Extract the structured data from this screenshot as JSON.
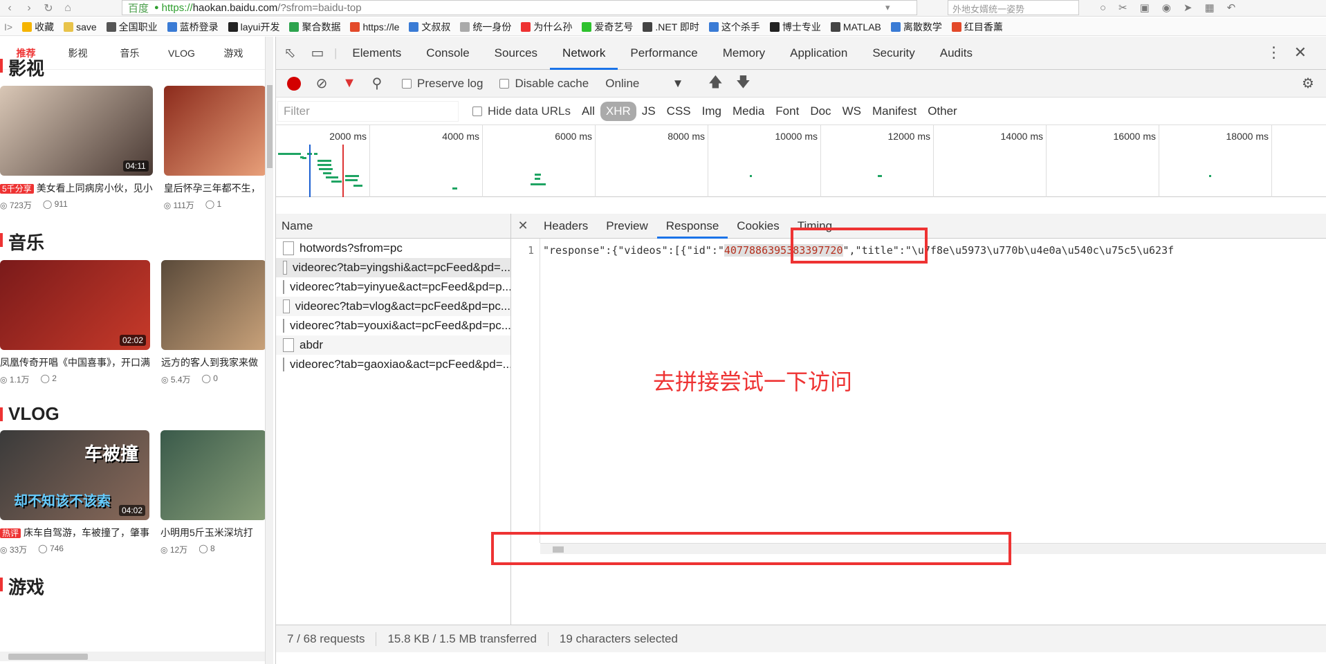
{
  "browser": {
    "site_badge": "百度",
    "url_https": "https://",
    "url_host": "haokan.baidu.com",
    "url_path": "/?sfrom=baidu-top",
    "search_placeholder": "外地女婿统一姿势"
  },
  "bookmarks": [
    {
      "label": "收藏",
      "color": "#f5b400"
    },
    {
      "label": "save",
      "color": "#e8c34a"
    },
    {
      "label": "全国职业",
      "color": "#555"
    },
    {
      "label": "蓝桥登录",
      "color": "#3a7bd5"
    },
    {
      "label": "layui开发",
      "color": "#222"
    },
    {
      "label": "聚合数据",
      "color": "#2ea44f"
    },
    {
      "label": "https://le",
      "color": "#e34a2a"
    },
    {
      "label": "文叔叔",
      "color": "#3a7bd5"
    },
    {
      "label": "统一身份",
      "color": "#aaa"
    },
    {
      "label": "为什么孙",
      "color": "#e33"
    },
    {
      "label": "爱奇艺号",
      "color": "#2ec22e"
    },
    {
      "label": ".NET 即时",
      "color": "#444"
    },
    {
      "label": "这个杀手",
      "color": "#3a7bd5"
    },
    {
      "label": "博士专业",
      "color": "#222"
    },
    {
      "label": "MATLAB",
      "color": "#444"
    },
    {
      "label": "离散数学",
      "color": "#3a7bd5"
    },
    {
      "label": "红目香薰",
      "color": "#e34a2a"
    }
  ],
  "page": {
    "tabs": [
      "推荐",
      "影视",
      "音乐",
      "VLOG",
      "游戏"
    ],
    "sections": [
      {
        "title": "影视",
        "cards": [
          {
            "duration": "04:11",
            "tag": "5千分享",
            "title": "美女看上同病房小伙，见小",
            "views": "723万",
            "comments": "911",
            "bg": "linear-gradient(135deg,#d9c7b6,#4a3a34)"
          },
          {
            "duration": "",
            "tag": "",
            "title": "皇后怀孕三年都不生，",
            "views": "111万",
            "comments": "1",
            "bg": "linear-gradient(135deg,#8c2b1c,#e8a07a)"
          }
        ]
      },
      {
        "title": "音乐",
        "cards": [
          {
            "duration": "02:02",
            "tag": "",
            "title": "凤凰传奇开唱《中国喜事》，开口满",
            "views": "1.1万",
            "comments": "2",
            "bg": "linear-gradient(135deg,#7a1a1a,#c73a2a)"
          },
          {
            "duration": "",
            "tag": "",
            "title": "远方的客人到我家来做",
            "views": "5.4万",
            "comments": "0",
            "bg": "linear-gradient(135deg,#5a4a3a,#c9a27a)"
          }
        ]
      },
      {
        "title": "VLOG",
        "cards": [
          {
            "duration": "04:02",
            "tag": "热评",
            "title": "床车自驾游，车被撞了，肇事",
            "views": "33万",
            "comments": "746",
            "bg": "linear-gradient(135deg,#3a3a3a,#8a6a5a)",
            "overlay1": "车被撞",
            "overlay2": "却不知该不该索"
          },
          {
            "duration": "",
            "tag": "",
            "title": "小明用5斤玉米深坑打",
            "views": "12万",
            "comments": "8",
            "bg": "linear-gradient(135deg,#3a5a4a,#8aa07a)"
          }
        ]
      },
      {
        "title": "游戏",
        "cards": []
      }
    ]
  },
  "devtools": {
    "tabs": [
      "Elements",
      "Console",
      "Sources",
      "Network",
      "Performance",
      "Memory",
      "Application",
      "Security",
      "Audits"
    ],
    "active_tab": "Network",
    "toolbar": {
      "preserve_log": "Preserve log",
      "disable_cache": "Disable cache",
      "throttle": "Online"
    },
    "filter": {
      "placeholder": "Filter",
      "hide_data_urls": "Hide data URLs",
      "types": [
        "All",
        "XHR",
        "JS",
        "CSS",
        "Img",
        "Media",
        "Font",
        "Doc",
        "WS",
        "Manifest",
        "Other"
      ],
      "active_type": "XHR"
    },
    "timeline_ticks": [
      "2000 ms",
      "4000 ms",
      "6000 ms",
      "8000 ms",
      "10000 ms",
      "12000 ms",
      "14000 ms",
      "16000 ms",
      "18000 ms"
    ],
    "name_header": "Name",
    "requests": [
      "hotwords?sfrom=pc",
      "videorec?tab=yingshi&act=pcFeed&pd=...",
      "videorec?tab=yinyue&act=pcFeed&pd=p...",
      "videorec?tab=vlog&act=pcFeed&pd=pc...",
      "videorec?tab=youxi&act=pcFeed&pd=pc...",
      "abdr",
      "videorec?tab=gaoxiao&act=pcFeed&pd=..."
    ],
    "selected_request": 1,
    "detail_tabs": [
      "Headers",
      "Preview",
      "Response",
      "Cookies",
      "Timing"
    ],
    "active_detail": "Response",
    "response": {
      "line_no": "1",
      "prefix": "\"response\":{\"videos\":[{\"id\":\"",
      "id_value": "4077886395383397720",
      "suffix": "\",\"title\":\"\\u7f8e\\u5973\\u770b\\u4e0a\\u540c\\u75c5\\u623f"
    },
    "annotation": "去拼接尝试一下访问",
    "status": {
      "requests": "7 / 68 requests",
      "transferred": "15.8 KB / 1.5 MB transferred",
      "selection": "19 characters selected"
    }
  }
}
